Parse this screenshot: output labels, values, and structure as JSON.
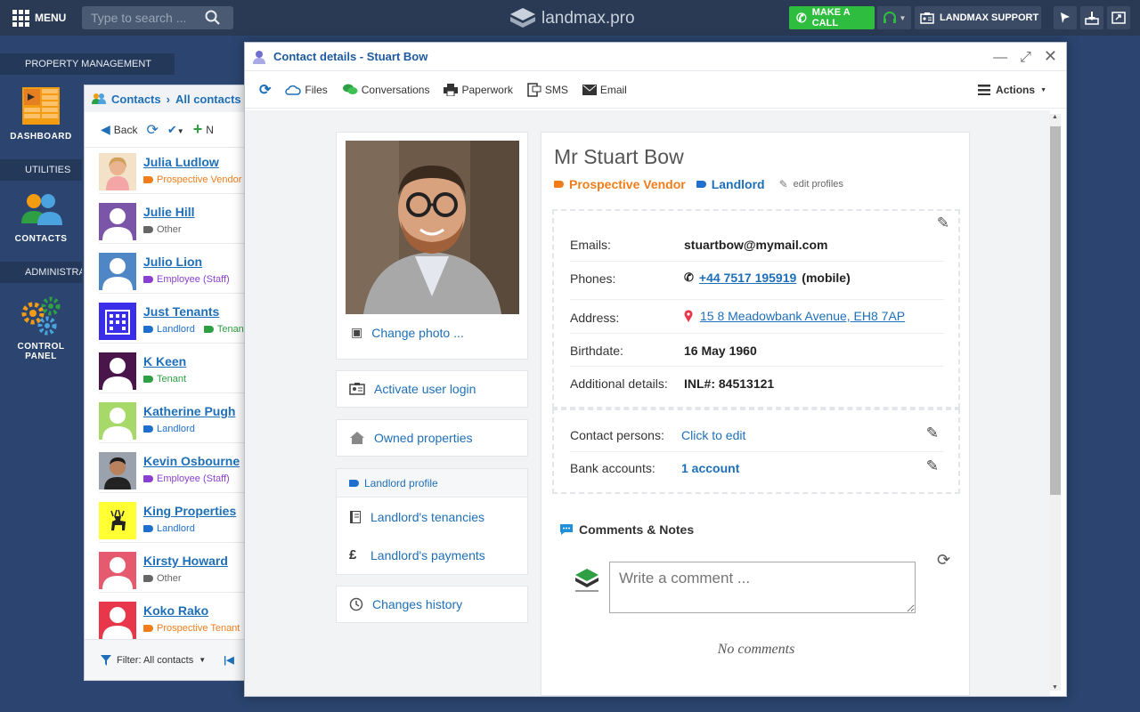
{
  "topbar": {
    "menu_label": "MENU",
    "search_placeholder": "Type to search ...",
    "logo_text": "landmax.pro",
    "call_label": "MAKE A CALL",
    "support_label": "LANDMAX SUPPORT"
  },
  "sidebar": {
    "sections": [
      {
        "label": "PROPERTY MANAGEMENT"
      },
      {
        "label": "UTILITIES"
      },
      {
        "label": "ADMINISTRATION"
      }
    ],
    "items": [
      {
        "label": "DASHBOARD"
      },
      {
        "label": "CONTACTS"
      },
      {
        "label": "CONTROL PANEL"
      }
    ]
  },
  "contacts": {
    "breadcrumb_root": "Contacts",
    "breadcrumb_sep": "›",
    "breadcrumb_current": "All contacts",
    "back_label": "Back",
    "new_label": "N",
    "filter_label": "Filter: All contacts",
    "list": [
      {
        "name": "Julia Ludlow",
        "tags": [
          {
            "label": "Prospective Vendor",
            "color": "#f07d1a"
          }
        ],
        "avatar": "photo-female",
        "bg": "#f3e2c7"
      },
      {
        "name": "Julie Hill",
        "tags": [
          {
            "label": "Other",
            "color": "#666666"
          }
        ],
        "avatar": "person",
        "bg": "#7b55a8"
      },
      {
        "name": "Julio Lion",
        "tags": [
          {
            "label": "Employee (Staff)",
            "color": "#8a3fd1"
          }
        ],
        "avatar": "person",
        "bg": "#4f86c6"
      },
      {
        "name": "Just Tenants",
        "tags": [
          {
            "label": "Landlord",
            "color": "#1e6fd0"
          },
          {
            "label": "Tenant",
            "color": "#2ea043"
          }
        ],
        "avatar": "building",
        "bg": "#3a2ee8"
      },
      {
        "name": "K Keen",
        "tags": [
          {
            "label": "Tenant",
            "color": "#2ea043"
          }
        ],
        "avatar": "person",
        "bg": "#4a154b"
      },
      {
        "name": "Katherine Pugh",
        "tags": [
          {
            "label": "Landlord",
            "color": "#1e6fd0"
          }
        ],
        "avatar": "person",
        "bg": "#a6d96a"
      },
      {
        "name": "Kevin Osbourne",
        "tags": [
          {
            "label": "Employee (Staff)",
            "color": "#8a3fd1"
          }
        ],
        "avatar": "photo-male",
        "bg": "#555555"
      },
      {
        "name": "King Properties",
        "tags": [
          {
            "label": "Landlord",
            "color": "#1e6fd0"
          }
        ],
        "avatar": "deer",
        "bg": "#ffff33"
      },
      {
        "name": "Kirsty Howard",
        "tags": [
          {
            "label": "Other",
            "color": "#666666"
          }
        ],
        "avatar": "person",
        "bg": "#e55a6e"
      },
      {
        "name": "Koko Rako",
        "tags": [
          {
            "label": "Prospective Tenant",
            "color": "#f07d1a"
          }
        ],
        "avatar": "person",
        "bg": "#e8364a"
      }
    ]
  },
  "modal": {
    "title": "Contact details - Stuart Bow",
    "toolbar": {
      "files": "Files",
      "conversations": "Conversations",
      "paperwork": "Paperwork",
      "sms": "SMS",
      "email": "Email",
      "actions": "Actions"
    },
    "left": {
      "change_photo": "Change photo ...",
      "activate_login": "Activate user login",
      "owned_properties": "Owned properties",
      "landlord_profile": "Landlord profile",
      "tenancies": "Landlord's tenancies",
      "payments": "Landlord's payments",
      "changes_history": "Changes history"
    },
    "contact": {
      "name": "Mr Stuart Bow",
      "tag1": "Prospective Vendor",
      "tag2": "Landlord",
      "edit_profiles": "edit profiles",
      "emails_label": "Emails:",
      "emails_value": "stuartbow@mymail.com",
      "phones_label": "Phones:",
      "phone_number": "+44 7517 195919",
      "phone_type": "(mobile)",
      "address_label": "Address:",
      "address_value": "15 8 Meadowbank Avenue, EH8 7AP",
      "birthdate_label": "Birthdate:",
      "birthdate_value": "16 May 1960",
      "additional_label": "Additional details:",
      "additional_value": "INL#: 84513121",
      "contact_persons_label": "Contact persons:",
      "contact_persons_value": "Click to edit",
      "bank_label": "Bank accounts:",
      "bank_value": "1 account"
    },
    "comments": {
      "title": "Comments & Notes",
      "placeholder": "Write a comment ...",
      "empty": "No comments"
    }
  },
  "colors": {
    "topbar": "#2a3a55",
    "sidebar": "#2b4570",
    "accent_blue": "#1e6fb8",
    "call_green": "#2ebd3e",
    "vendor_orange": "#f07d1a"
  }
}
